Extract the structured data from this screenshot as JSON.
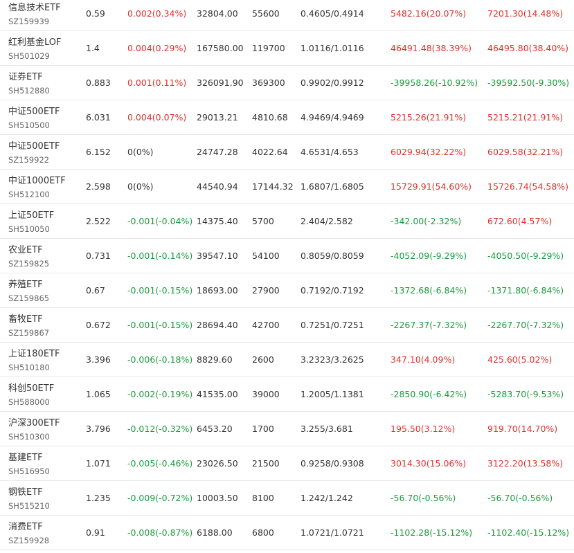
{
  "colors": {
    "up": "#e0312c",
    "down": "#1a9b3c",
    "flat": "#333333"
  },
  "rows": [
    {
      "name": "信息技术ETF",
      "code": "SZ159939",
      "price": "0.59",
      "change": "0.002(0.34%)",
      "change_dir": "up",
      "amount": "32804.00",
      "shares": "55600",
      "cost": "0.4605/0.4914",
      "profit": "5482.16(20.07%)",
      "profit_dir": "up",
      "total": "7201.30(14.48%)",
      "total_dir": "up"
    },
    {
      "name": "红利基金LOF",
      "code": "SH501029",
      "price": "1.4",
      "change": "0.004(0.29%)",
      "change_dir": "up",
      "amount": "167580.00",
      "shares": "119700",
      "cost": "1.0116/1.0116",
      "profit": "46491.48(38.39%)",
      "profit_dir": "up",
      "total": "46495.80(38.40%)",
      "total_dir": "up"
    },
    {
      "name": "证券ETF",
      "code": "SH512880",
      "price": "0.883",
      "change": "0.001(0.11%)",
      "change_dir": "up",
      "amount": "326091.90",
      "shares": "369300",
      "cost": "0.9902/0.9912",
      "profit": "-39958.26(-10.92%)",
      "profit_dir": "down",
      "total": "-39592.50(-9.30%)",
      "total_dir": "down"
    },
    {
      "name": "中证500ETF",
      "code": "SH510500",
      "price": "6.031",
      "change": "0.004(0.07%)",
      "change_dir": "up",
      "amount": "29013.21",
      "shares": "4810.68",
      "cost": "4.9469/4.9469",
      "profit": "5215.26(21.91%)",
      "profit_dir": "up",
      "total": "5215.21(21.91%)",
      "total_dir": "up"
    },
    {
      "name": "中证500ETF",
      "code": "SZ159922",
      "price": "6.152",
      "change": "0(0%)",
      "change_dir": "flat",
      "amount": "24747.28",
      "shares": "4022.64",
      "cost": "4.6531/4.653",
      "profit": "6029.94(32.22%)",
      "profit_dir": "up",
      "total": "6029.58(32.21%)",
      "total_dir": "up"
    },
    {
      "name": "中证1000ETF",
      "code": "SH512100",
      "price": "2.598",
      "change": "0(0%)",
      "change_dir": "flat",
      "amount": "44540.94",
      "shares": "17144.32",
      "cost": "1.6807/1.6805",
      "profit": "15729.91(54.60%)",
      "profit_dir": "up",
      "total": "15726.74(54.58%)",
      "total_dir": "up"
    },
    {
      "name": "上证50ETF",
      "code": "SH510050",
      "price": "2.522",
      "change": "-0.001(-0.04%)",
      "change_dir": "down",
      "amount": "14375.40",
      "shares": "5700",
      "cost": "2.404/2.582",
      "profit": "-342.00(-2.32%)",
      "profit_dir": "down",
      "total": "672.60(4.57%)",
      "total_dir": "up"
    },
    {
      "name": "农业ETF",
      "code": "SZ159825",
      "price": "0.731",
      "change": "-0.001(-0.14%)",
      "change_dir": "down",
      "amount": "39547.10",
      "shares": "54100",
      "cost": "0.8059/0.8059",
      "profit": "-4052.09(-9.29%)",
      "profit_dir": "down",
      "total": "-4050.50(-9.29%)",
      "total_dir": "down"
    },
    {
      "name": "养殖ETF",
      "code": "SZ159865",
      "price": "0.67",
      "change": "-0.001(-0.15%)",
      "change_dir": "down",
      "amount": "18693.00",
      "shares": "27900",
      "cost": "0.7192/0.7192",
      "profit": "-1372.68(-6.84%)",
      "profit_dir": "down",
      "total": "-1371.80(-6.84%)",
      "total_dir": "down"
    },
    {
      "name": "畜牧ETF",
      "code": "SZ159867",
      "price": "0.672",
      "change": "-0.001(-0.15%)",
      "change_dir": "down",
      "amount": "28694.40",
      "shares": "42700",
      "cost": "0.7251/0.7251",
      "profit": "-2267.37(-7.32%)",
      "profit_dir": "down",
      "total": "-2267.70(-7.32%)",
      "total_dir": "down"
    },
    {
      "name": "上证180ETF",
      "code": "SH510180",
      "price": "3.396",
      "change": "-0.006(-0.18%)",
      "change_dir": "down",
      "amount": "8829.60",
      "shares": "2600",
      "cost": "3.2323/3.2625",
      "profit": "347.10(4.09%)",
      "profit_dir": "up",
      "total": "425.60(5.02%)",
      "total_dir": "up"
    },
    {
      "name": "科创50ETF",
      "code": "SH588000",
      "price": "1.065",
      "change": "-0.002(-0.19%)",
      "change_dir": "down",
      "amount": "41535.00",
      "shares": "39000",
      "cost": "1.2005/1.1381",
      "profit": "-2850.90(-6.42%)",
      "profit_dir": "down",
      "total": "-5283.70(-9.53%)",
      "total_dir": "down"
    },
    {
      "name": "沪深300ETF",
      "code": "SH510300",
      "price": "3.796",
      "change": "-0.012(-0.32%)",
      "change_dir": "down",
      "amount": "6453.20",
      "shares": "1700",
      "cost": "3.255/3.681",
      "profit": "195.50(3.12%)",
      "profit_dir": "up",
      "total": "919.70(14.70%)",
      "total_dir": "up"
    },
    {
      "name": "基建ETF",
      "code": "SH516950",
      "price": "1.071",
      "change": "-0.005(-0.46%)",
      "change_dir": "down",
      "amount": "23026.50",
      "shares": "21500",
      "cost": "0.9258/0.9308",
      "profit": "3014.30(15.06%)",
      "profit_dir": "up",
      "total": "3122.20(13.58%)",
      "total_dir": "up"
    },
    {
      "name": "钢铁ETF",
      "code": "SH515210",
      "price": "1.235",
      "change": "-0.009(-0.72%)",
      "change_dir": "down",
      "amount": "10003.50",
      "shares": "8100",
      "cost": "1.242/1.242",
      "profit": "-56.70(-0.56%)",
      "profit_dir": "down",
      "total": "-56.70(-0.56%)",
      "total_dir": "down"
    },
    {
      "name": "消费ETF",
      "code": "SZ159928",
      "price": "0.91",
      "change": "-0.008(-0.87%)",
      "change_dir": "down",
      "amount": "6188.00",
      "shares": "6800",
      "cost": "1.0721/1.0721",
      "profit": "-1102.28(-15.12%)",
      "profit_dir": "down",
      "total": "-1102.40(-15.12%)",
      "total_dir": "down"
    }
  ]
}
